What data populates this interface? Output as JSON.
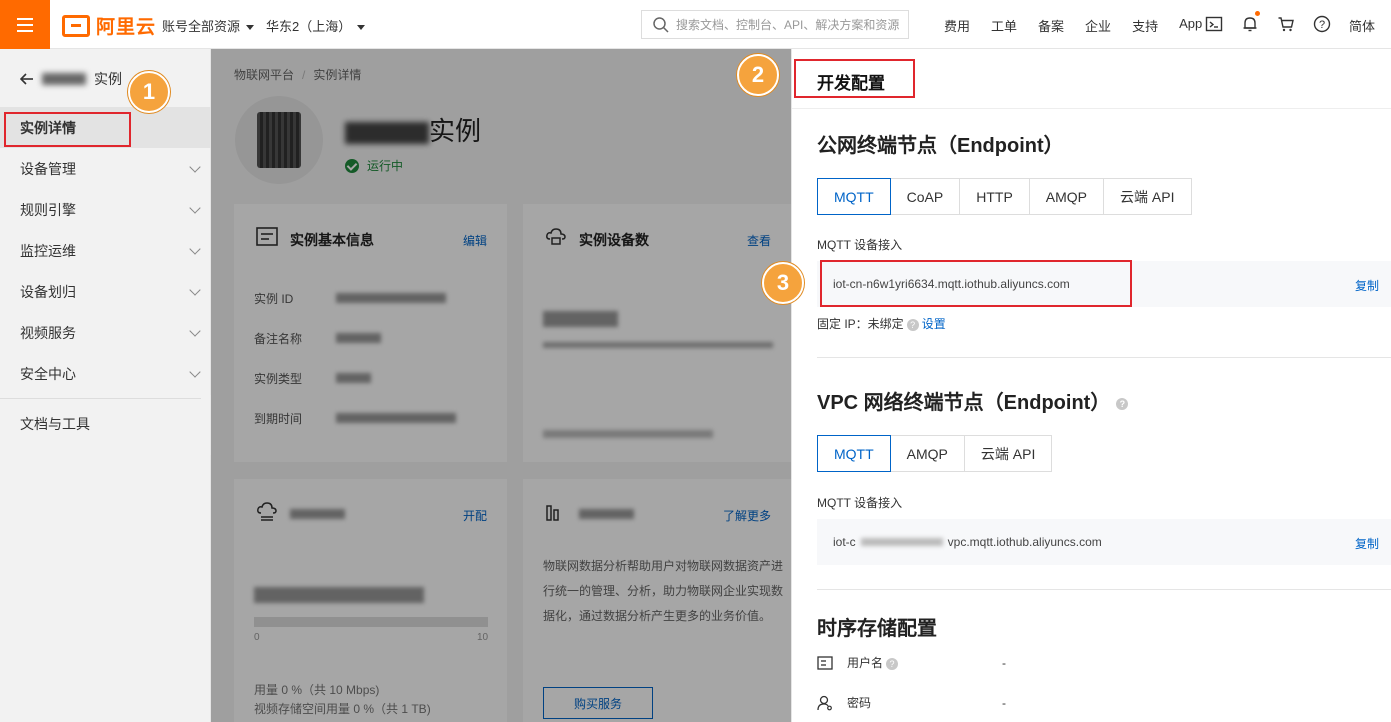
{
  "topbar": {
    "brand": "阿里云",
    "account_scope": "账号全部资源",
    "region": "华东2（上海）",
    "search_placeholder": "搜索文档、控制台、API、解决方案和资源",
    "links": [
      "费用",
      "工单",
      "备案",
      "企业",
      "支持",
      "App"
    ],
    "lang": "简体",
    "icons": [
      "terminal-icon",
      "bell-icon",
      "cart-icon",
      "help-icon"
    ],
    "accent": "#ff6a00"
  },
  "sidebar": {
    "back_label": "实例",
    "items": [
      {
        "label": "实例详情",
        "active": true
      },
      {
        "label": "设备管理"
      },
      {
        "label": "规则引擎"
      },
      {
        "label": "监控运维"
      },
      {
        "label": "设备划归"
      },
      {
        "label": "视频服务"
      },
      {
        "label": "安全中心"
      }
    ],
    "footer_item": "文档与工具"
  },
  "main": {
    "breadcrumb": [
      "物联网平台",
      "实例详情"
    ],
    "instance_title_suffix": "实例",
    "status": "运行中",
    "basic_card": {
      "title": "实例基本信息",
      "action": "编辑",
      "fields": [
        {
          "label": "实例 ID"
        },
        {
          "label": "备注名称"
        },
        {
          "label": "实例类型"
        },
        {
          "label": "到期时间"
        }
      ]
    },
    "device_card": {
      "title": "实例设备数",
      "action": "查看"
    },
    "bandwidth_card": {
      "action": "开配",
      "axis_min": "0",
      "axis_max": "10",
      "usage_lines": [
        "用量 0 %（共 10 Mbps)",
        "视频存储空间用量 0 %（共 1 TB)"
      ]
    },
    "analytics_card": {
      "action": "了解更多",
      "description": "物联网数据分析帮助用户对物联网数据资产进行统一的管理、分析，助力物联网企业实现数据化，通过数据分析产生更多的业务价值。",
      "button": "购买服务"
    }
  },
  "drawer": {
    "title": "开发配置",
    "public": {
      "title": "公网终端节点（Endpoint）",
      "tabs": [
        "MQTT",
        "CoAP",
        "HTTP",
        "AMQP",
        "云端 API"
      ],
      "selected_tab": "MQTT",
      "field_label": "MQTT 设备接入",
      "endpoint": "iot-cn-n6w1yri6634.mqtt.iothub.aliyuncs.com",
      "copy": "复制",
      "fixed_ip_label": "固定 IP：未绑定",
      "fixed_ip_action": "设置"
    },
    "vpc": {
      "title": "VPC 网络终端节点（Endpoint）",
      "tabs": [
        "MQTT",
        "AMQP",
        "云端 API"
      ],
      "selected_tab": "MQTT",
      "field_label": "MQTT 设备接入",
      "endpoint_prefix": "iot-c",
      "endpoint_suffix": "vpc.mqtt.iothub.aliyuncs.com",
      "copy": "复制"
    },
    "storage": {
      "title": "时序存储配置",
      "rows": [
        {
          "label": "用户名",
          "value": "-"
        },
        {
          "label": "密码",
          "value": "-"
        }
      ]
    }
  },
  "annotations": {
    "badges": [
      "1",
      "2",
      "3"
    ],
    "highlight_color": "#e0262d",
    "badge_color": "#f5a33d"
  }
}
